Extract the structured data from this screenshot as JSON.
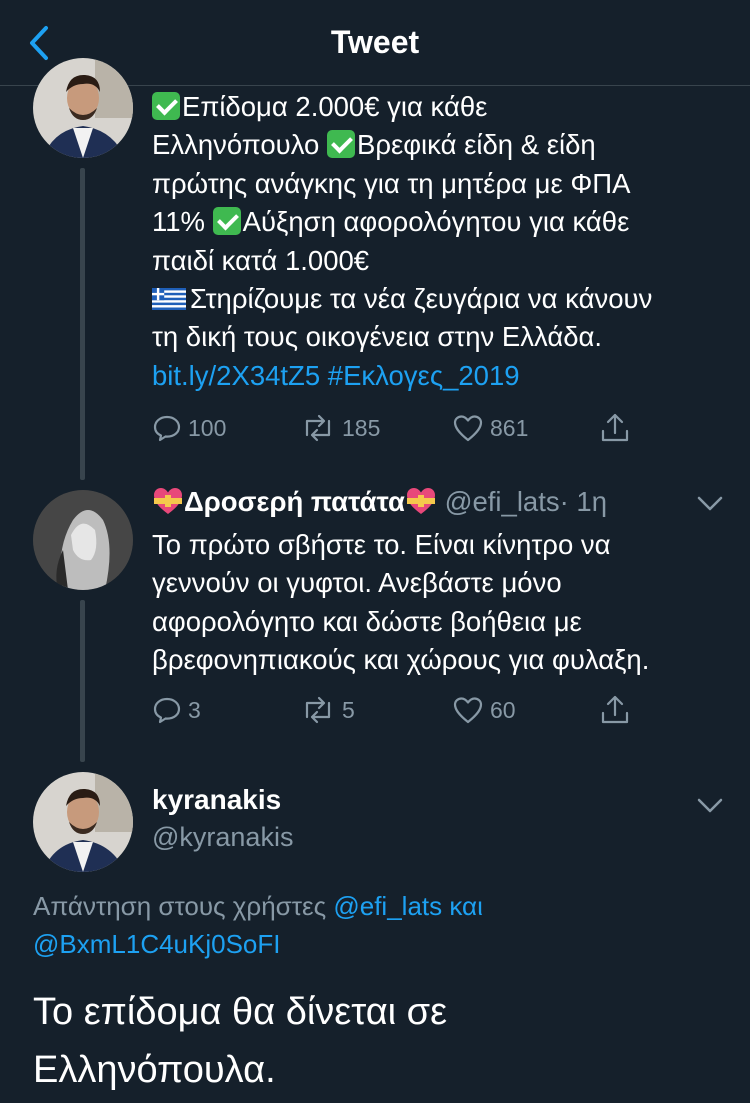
{
  "header": {
    "title": "Tweet",
    "back_icon": "chevron-left-icon"
  },
  "colors": {
    "background": "#15202b",
    "accent": "#1da1f2",
    "muted": "#8899a6",
    "divider": "#38444d"
  },
  "tweet1": {
    "line1": "Επίδομα 2.000€ για κάθε",
    "line2a": "Ελληνόπουλο",
    "line2b": "Βρεφικά είδη & είδη",
    "line3": "πρώτης ανάγκης για τη μητέρα με ΦΠΑ",
    "line4a": "11%",
    "line4b": "Αύξηση αφορολόγητου για κάθε",
    "line5": "παιδί κατά 1.000€",
    "line6": "Στηρίζουμε τα νέα ζευγάρια να κάνουν",
    "line7": "τη δική τους οικογένεια στην Ελλάδα.",
    "link": "bit.ly/2X34tZ5",
    "hashtag": "#Εκλογες_2019",
    "replies": "100",
    "retweets": "185",
    "likes": "861"
  },
  "tweet2": {
    "display_name": "Δροσερή πατάτα",
    "handle": "@efi_lats",
    "time": "· 1η",
    "text_lines": [
      "Το πρώτο σβήστε το. Είναι κίνητρο να",
      "γεννούν οι γυφτοι. Ανεβάστε μόνο",
      "αφορολόγητο και δώστε βοήθεια με",
      "βρεφονηπιακούς και χώρους για φυλαξη."
    ],
    "replies": "3",
    "retweets": "5",
    "likes": "60"
  },
  "tweet3": {
    "display_name": "kyranakis",
    "handle": "@kyranakis",
    "reply_prefix": "Απάντηση στους χρήστες",
    "reply_user1": "@efi_lats",
    "reply_and": "και",
    "reply_user2": "@BxmL1C4uKj0SoFI",
    "text_line1": "Το επίδομα θα δίνεται σε",
    "text_line2": "Ελληνόπουλα."
  }
}
